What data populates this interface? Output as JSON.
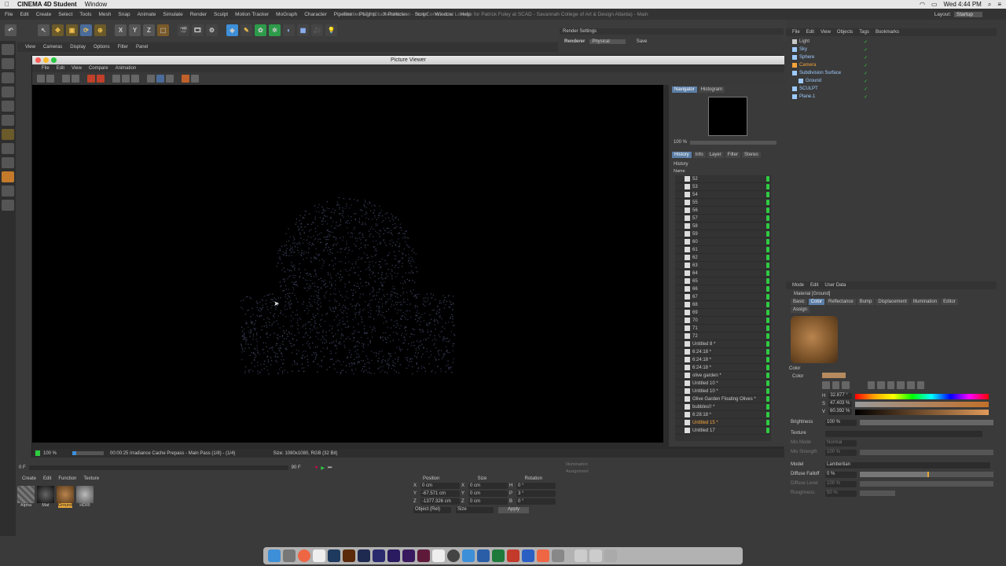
{
  "mac_menu": {
    "app": "CINEMA 4D Student",
    "window": "Window",
    "clock": "Wed 4:44 PM"
  },
  "c4d_menu": {
    "items": [
      "File",
      "Edit",
      "Create",
      "Select",
      "Tools",
      "Mesh",
      "Snap",
      "Animate",
      "Simulate",
      "Render",
      "Sculpt",
      "Motion Tracker",
      "MoGraph",
      "Character",
      "Pipeline",
      "Plugins",
      "X-Particles",
      "Script",
      "Window",
      "Help"
    ],
    "title": "Untitled 17 * (Student Version - Non-Commercial License for Patrick Foley at SCAD - Savannah College of Art & Design Atlanta) - Main",
    "layout_label": "Layout:",
    "layout_value": "Startup"
  },
  "toolbar": {
    "x": "X",
    "y": "Y",
    "z": "Z"
  },
  "viewport_menu": [
    "View",
    "Cameras",
    "Display",
    "Options",
    "Filter",
    "Panel"
  ],
  "render_settings": {
    "title": "Render Settings",
    "renderer_label": "Renderer",
    "renderer_value": "Physical",
    "save": "Save"
  },
  "picture_viewer": {
    "title": "Picture Viewer",
    "menu": [
      "File",
      "Edit",
      "View",
      "Compare",
      "Animation"
    ],
    "nav_tabs": [
      "Navigator",
      "Histogram"
    ],
    "zoom": "100 %",
    "hist_tabs": [
      "History",
      "Info",
      "Layer",
      "Filter",
      "Stereo"
    ],
    "history_label": "History",
    "name_col": "Name",
    "history_items": [
      "52",
      "53",
      "54",
      "55",
      "56",
      "57",
      "58",
      "59",
      "60",
      "61",
      "62",
      "63",
      "64",
      "65",
      "66",
      "67",
      "68",
      "69",
      "70",
      "71",
      "72",
      "Untitled 8 *",
      "6:24:18 *",
      "6:24:18 *",
      "6:24:18 *",
      "olive garden *",
      "Untitled 10 *",
      "Untitled 10 *",
      "Olive Garden Floating Olives *",
      "bubbles!! *",
      "6:28:18 *",
      "Untitled 15 *",
      "Untitled 17"
    ],
    "status_zoom": "100 %",
    "status_text": "00:00:25 Irradiance Cache Prepass - Main Pass (1/8) - (1/4)",
    "status_size": "Size: 1080x1080, RGB (32 Bit)"
  },
  "object_manager": {
    "menu": [
      "File",
      "Edit",
      "View",
      "Objects",
      "Tags",
      "Bookmarks"
    ],
    "objects": [
      {
        "name": "Light",
        "color": "#c8c8c8",
        "indent": 0
      },
      {
        "name": "Sky",
        "color": "#9ecbff",
        "indent": 0
      },
      {
        "name": "Sphere",
        "color": "#9ecbff",
        "indent": 0
      },
      {
        "name": "Camera",
        "color": "#f3a33a",
        "indent": 0
      },
      {
        "name": "Subdivision Surface",
        "color": "#9ecbff",
        "indent": 0
      },
      {
        "name": "Ground",
        "color": "#9ecbff",
        "indent": 1
      },
      {
        "name": "SCULPT",
        "color": "#9ecbff",
        "indent": 0
      },
      {
        "name": "Plane.1",
        "color": "#9ecbff",
        "indent": 0
      }
    ]
  },
  "attributes": {
    "menu": [
      "Mode",
      "Edit",
      "User Data"
    ],
    "material": "Material [Ground]",
    "tabs": [
      "Basic",
      "Color",
      "Reflectance",
      "Bump",
      "Displacement",
      "Illumination",
      "Editor",
      "Assign"
    ],
    "active_tab": "Color",
    "section": "Color",
    "color_label": "Color",
    "h": "32.877 °",
    "s": "47.403 %",
    "v": "60.392 %",
    "h_label": "H",
    "s_label": "S",
    "v_label": "V",
    "brightness_label": "Brightness",
    "brightness": "100 %",
    "texture_label": "Texture",
    "mix_mode_label": "Mix Mode",
    "mix_mode": "Normal",
    "mix_strength_label": "Mix Strength",
    "mix_strength": "100 %",
    "model_label": "Model",
    "model": "Lambertian",
    "diffuse_falloff_label": "Diffuse Falloff",
    "diffuse_falloff": "0 %",
    "diffuse_level_label": "Diffuse Level",
    "diffuse_level": "100 %",
    "roughness_label": "Roughness",
    "roughness": "50 %"
  },
  "material_manager": {
    "menu": [
      "Create",
      "Edit",
      "Function",
      "Texture"
    ],
    "materials": [
      "Alpha",
      "Mat",
      "Ground",
      "HDRI"
    ]
  },
  "coordinates": {
    "headers": [
      "Position",
      "Size",
      "Rotation"
    ],
    "rows": [
      [
        "X",
        "0 cm",
        "X",
        "0 cm",
        "H",
        "0 °"
      ],
      [
        "Y",
        "-67.571 cm",
        "Y",
        "0 cm",
        "P",
        "3 °"
      ],
      [
        "Z",
        "-1377.326 cm",
        "Z",
        "0 cm",
        "B",
        "0 °"
      ]
    ],
    "mode": "Object (Rel)",
    "size_mode": "Size",
    "apply": "Apply"
  },
  "timeline": {
    "start": "0 F",
    "end": "90 F"
  },
  "side_labels": {
    "illumination": "Illumination",
    "assignment": "Assignment"
  }
}
